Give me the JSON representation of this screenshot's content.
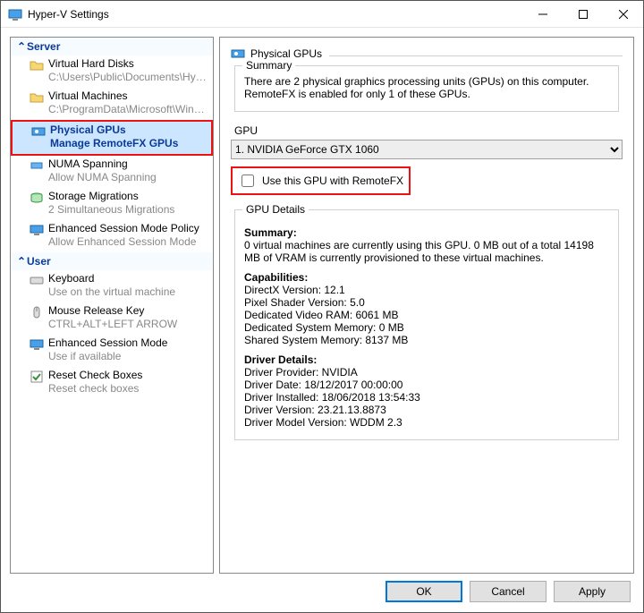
{
  "window": {
    "title": "Hyper-V Settings"
  },
  "nav": {
    "server": {
      "header": "Server",
      "items": [
        {
          "title": "Virtual Hard Disks",
          "sub": "C:\\Users\\Public\\Documents\\Hyper-…"
        },
        {
          "title": "Virtual Machines",
          "sub": "C:\\ProgramData\\Microsoft\\Windo…"
        },
        {
          "title": "Physical GPUs",
          "sub": "Manage RemoteFX GPUs",
          "selected": true
        },
        {
          "title": "NUMA Spanning",
          "sub": "Allow NUMA Spanning"
        },
        {
          "title": "Storage Migrations",
          "sub": "2 Simultaneous Migrations"
        },
        {
          "title": "Enhanced Session Mode Policy",
          "sub": "Allow Enhanced Session Mode"
        }
      ]
    },
    "user": {
      "header": "User",
      "items": [
        {
          "title": "Keyboard",
          "sub": "Use on the virtual machine"
        },
        {
          "title": "Mouse Release Key",
          "sub": "CTRL+ALT+LEFT ARROW"
        },
        {
          "title": "Enhanced Session Mode",
          "sub": "Use if available"
        },
        {
          "title": "Reset Check Boxes",
          "sub": "Reset check boxes"
        }
      ]
    }
  },
  "page": {
    "title": "Physical GPUs",
    "summary": {
      "label": "Summary",
      "text": "There are 2 physical graphics processing units (GPUs) on this computer. RemoteFX is enabled for only 1 of these GPUs."
    },
    "gpu": {
      "label": "GPU",
      "selected": "1. NVIDIA GeForce GTX 1060",
      "checkbox": "Use this GPU with RemoteFX"
    },
    "details": {
      "label": "GPU Details",
      "summary_head": "Summary:",
      "summary_text": "0 virtual machines are currently using this GPU. 0 MB out of a total 14198 MB of VRAM is currently provisioned to these virtual machines.",
      "capabilities_head": "Capabilities:",
      "capabilities": [
        "DirectX Version: 12.1",
        "Pixel Shader Version: 5.0",
        "Dedicated Video RAM: 6061 MB",
        "Dedicated System Memory: 0 MB",
        "Shared System Memory: 8137 MB"
      ],
      "driver_head": "Driver Details:",
      "driver": [
        "Driver Provider: NVIDIA",
        "Driver Date: 18/12/2017 00:00:00",
        "Driver Installed: 18/06/2018 13:54:33",
        "Driver Version: 23.21.13.8873",
        "Driver Model Version: WDDM 2.3"
      ]
    }
  },
  "buttons": {
    "ok": "OK",
    "cancel": "Cancel",
    "apply": "Apply"
  }
}
